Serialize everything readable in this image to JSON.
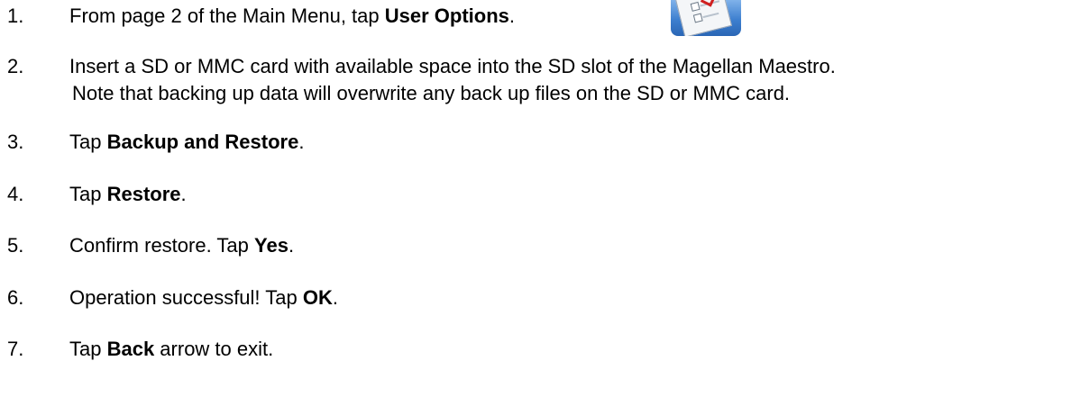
{
  "steps": [
    {
      "num": "1.",
      "pre": "From page 2 of the Main Menu, tap ",
      "bold": "User Options",
      "post": "."
    },
    {
      "num": "2.",
      "line1": "Insert a SD or MMC card with available space into the SD slot of the Magellan Maestro.",
      "line2": "Note that backing up data will overwrite any back up files on the SD or MMC card."
    },
    {
      "num": "3.",
      "pre": "Tap ",
      "bold": "Backup and Restore",
      "post": "."
    },
    {
      "num": "4.",
      "pre": "Tap ",
      "bold": "Restore",
      "post": "."
    },
    {
      "num": "5.",
      "pre": "Confirm restore.  Tap ",
      "bold": "Yes",
      "post": "."
    },
    {
      "num": "6.",
      "pre": "Operation successful!  Tap ",
      "bold": "OK",
      "post": "."
    },
    {
      "num": "7.",
      "pre": "Tap ",
      "bold": "Back",
      "post": " arrow to exit."
    }
  ],
  "icons": {
    "user_options": "user-options-checklist-icon"
  }
}
